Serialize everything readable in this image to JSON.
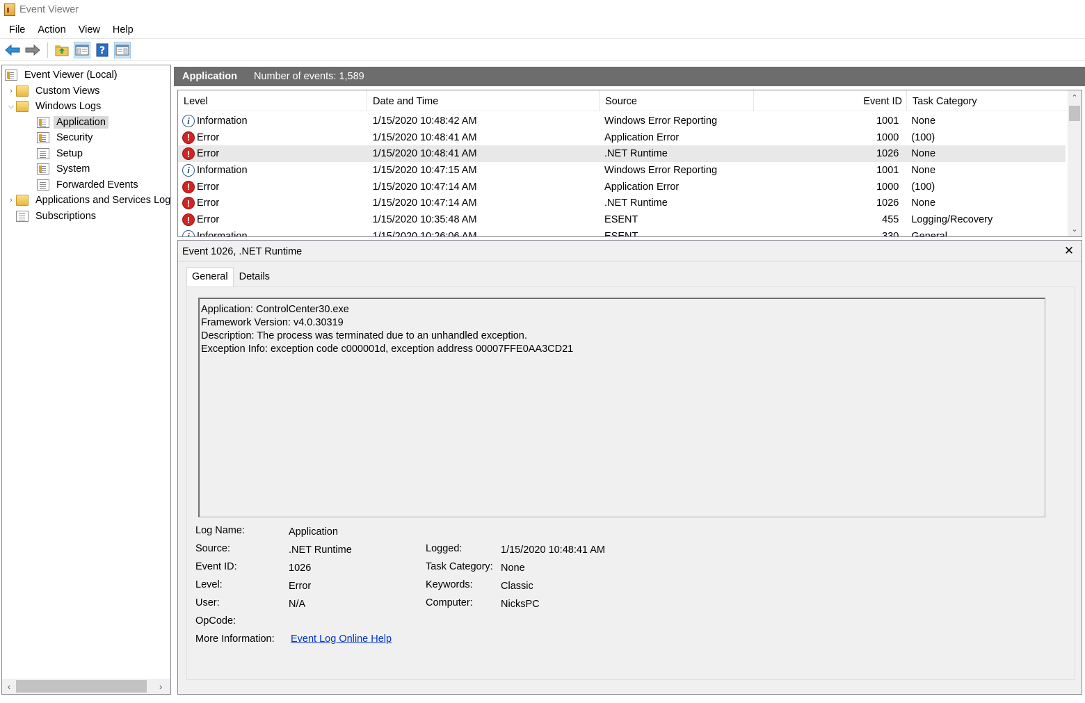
{
  "window": {
    "title": "Event Viewer"
  },
  "menu": [
    "File",
    "Action",
    "View",
    "Help"
  ],
  "toolbar": {
    "buttons": [
      "back-icon",
      "forward-icon",
      "folder-up-icon",
      "show-hide-console-tree-icon",
      "help-icon",
      "action-pane-icon"
    ]
  },
  "tree": {
    "root": "Event Viewer (Local)",
    "custom_views": "Custom Views",
    "windows_logs": "Windows Logs",
    "logs": [
      "Application",
      "Security",
      "Setup",
      "System",
      "Forwarded Events"
    ],
    "apps_services": "Applications and Services Log",
    "subscriptions": "Subscriptions"
  },
  "header": {
    "title": "Application",
    "count": "Number of events: 1,589"
  },
  "grid": {
    "columns": [
      "Level",
      "Date and Time",
      "Source",
      "Event ID",
      "Task Category"
    ],
    "rows": [
      {
        "level": "Information",
        "datetime": "1/15/2020 10:48:42 AM",
        "source": "Windows Error Reporting",
        "event_id": "1001",
        "category": "None"
      },
      {
        "level": "Error",
        "datetime": "1/15/2020 10:48:41 AM",
        "source": "Application Error",
        "event_id": "1000",
        "category": "(100)"
      },
      {
        "level": "Error",
        "datetime": "1/15/2020 10:48:41 AM",
        "source": ".NET Runtime",
        "event_id": "1026",
        "category": "None"
      },
      {
        "level": "Information",
        "datetime": "1/15/2020 10:47:15 AM",
        "source": "Windows Error Reporting",
        "event_id": "1001",
        "category": "None"
      },
      {
        "level": "Error",
        "datetime": "1/15/2020 10:47:14 AM",
        "source": "Application Error",
        "event_id": "1000",
        "category": "(100)"
      },
      {
        "level": "Error",
        "datetime": "1/15/2020 10:47:14 AM",
        "source": ".NET Runtime",
        "event_id": "1026",
        "category": "None"
      },
      {
        "level": "Error",
        "datetime": "1/15/2020 10:35:48 AM",
        "source": "ESENT",
        "event_id": "455",
        "category": "Logging/Recovery"
      },
      {
        "level": "Information",
        "datetime": "1/15/2020 10:26:06 AM",
        "source": "ESENT",
        "event_id": "330",
        "category": "General"
      }
    ]
  },
  "detail": {
    "title": "Event 1026, .NET Runtime",
    "tabs": [
      "General",
      "Details"
    ],
    "description": [
      "Application: ControlCenter30.exe",
      "Framework Version: v4.0.30319",
      "Description: The process was terminated due to an unhandled exception.",
      "Exception Info: exception code c000001d, exception address 00007FFE0AA3CD21"
    ],
    "labels": {
      "log_name": "Log Name:",
      "source": "Source:",
      "event_id": "Event ID:",
      "level": "Level:",
      "user": "User:",
      "opcode": "OpCode:",
      "more_info": "More Information:",
      "logged": "Logged:",
      "task_category": "Task Category:",
      "keywords": "Keywords:",
      "computer": "Computer:"
    },
    "values": {
      "log_name": "Application",
      "source": ".NET Runtime",
      "event_id": "1026",
      "level": "Error",
      "user": "N/A",
      "opcode": "",
      "more_info": "Event Log Online Help",
      "logged": "1/15/2020 10:48:41 AM",
      "task_category": "None",
      "keywords": "Classic",
      "computer": "NicksPC"
    }
  },
  "colors": {
    "header_bg": "#6d6d6d",
    "error": "#d32424",
    "link": "#0033cc"
  }
}
